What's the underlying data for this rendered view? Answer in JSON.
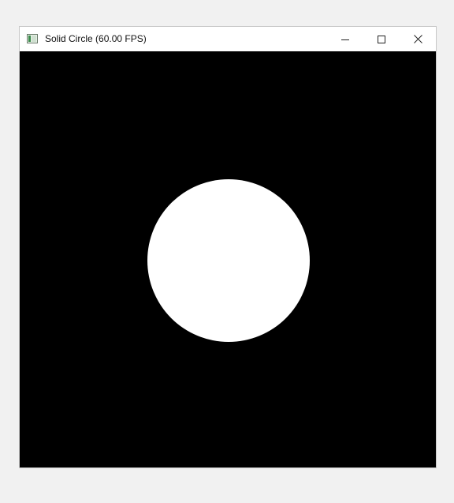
{
  "window": {
    "title": "Solid Circle (60.00 FPS)",
    "icon": "app-window-icon",
    "controls": [
      {
        "name": "minimize",
        "icon": "minimize-icon"
      },
      {
        "name": "maximize",
        "icon": "maximize-icon"
      },
      {
        "name": "close",
        "icon": "close-icon"
      }
    ]
  },
  "canvas": {
    "background_color": "#000000",
    "shape": "circle",
    "fill_color": "#ffffff"
  }
}
